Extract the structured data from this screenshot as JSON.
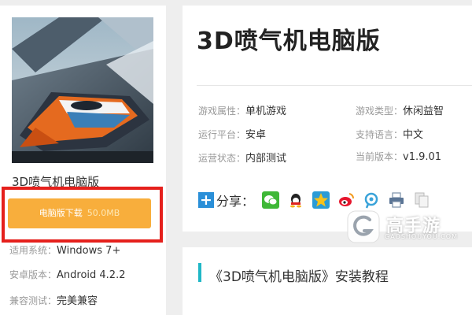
{
  "game": {
    "name": "3D喷气机电脑版",
    "download_label": "电脑版下载",
    "download_size": "50.0MB",
    "system_label": "适用系统：",
    "system_value": "Windows 7+",
    "android_label": "安卓版本：",
    "android_value": "Android 4.2.2",
    "compat_label": "兼容测试：",
    "compat_value": "完美兼容"
  },
  "main": {
    "title": "3D喷气机电脑版",
    "attrs": {
      "attr_label": "游戏属性：",
      "attr_value": "单机游戏",
      "type_label": "游戏类型：",
      "type_value": "休闲益智",
      "platform_label": "运行平台：",
      "platform_value": "安卓",
      "lang_label": "支持语言：",
      "lang_value": "中文",
      "status_label": "运营状态：",
      "status_value": "内部测试",
      "version_label": "当前版本：",
      "version_value": "v1.9.01"
    },
    "share_label": "分享：",
    "share_icons": [
      "wechat-icon",
      "qq-icon",
      "qzone-icon",
      "weibo-icon",
      "tencent-weibo-icon",
      "print-icon",
      "copy-icon"
    ]
  },
  "section": {
    "title": "《3D喷气机电脑版》安装教程"
  },
  "watermark": {
    "text": "高手游",
    "sub": "GAOSHOUYOU.COM"
  },
  "colors": {
    "download_button": "#f8ae3c",
    "highlight_frame": "#e5201c",
    "accent_bar": "#20b7c6",
    "share_plus": "#2a8fd8"
  }
}
